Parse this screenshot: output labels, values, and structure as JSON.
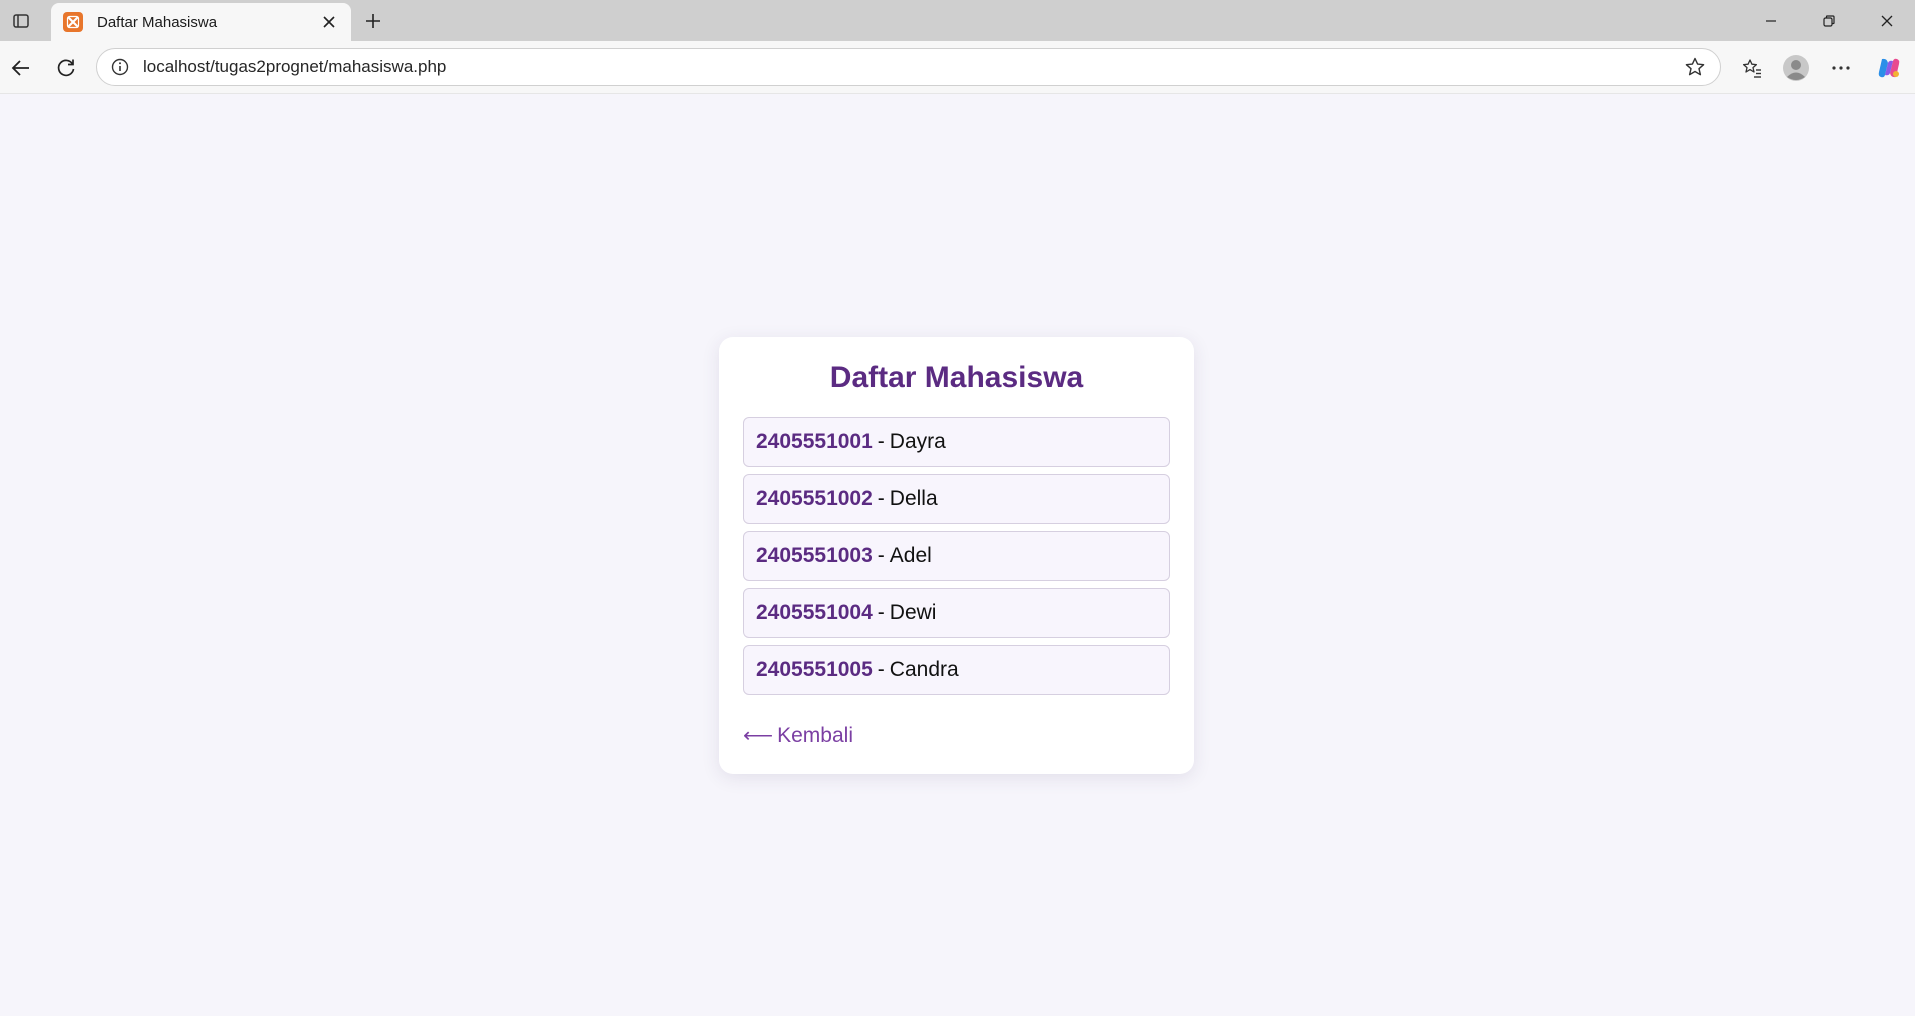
{
  "browser": {
    "tab_title": "Daftar Mahasiswa",
    "url": "localhost/tugas2prognet/mahasiswa.php",
    "favicon_color": "#e8762c"
  },
  "page": {
    "title": "Daftar Mahasiswa",
    "separator": "-",
    "students": [
      {
        "nim": "2405551001",
        "name": "Dayra"
      },
      {
        "nim": "2405551002",
        "name": "Della"
      },
      {
        "nim": "2405551003",
        "name": "Adel"
      },
      {
        "nim": "2405551004",
        "name": "Dewi"
      },
      {
        "nim": "2405551005",
        "name": "Candra"
      }
    ],
    "back_arrow": "⟵",
    "back_label": "Kembali"
  },
  "colors": {
    "accent": "#5b2b82",
    "link": "#7b3fa3",
    "page_bg": "#f6f5fb"
  }
}
